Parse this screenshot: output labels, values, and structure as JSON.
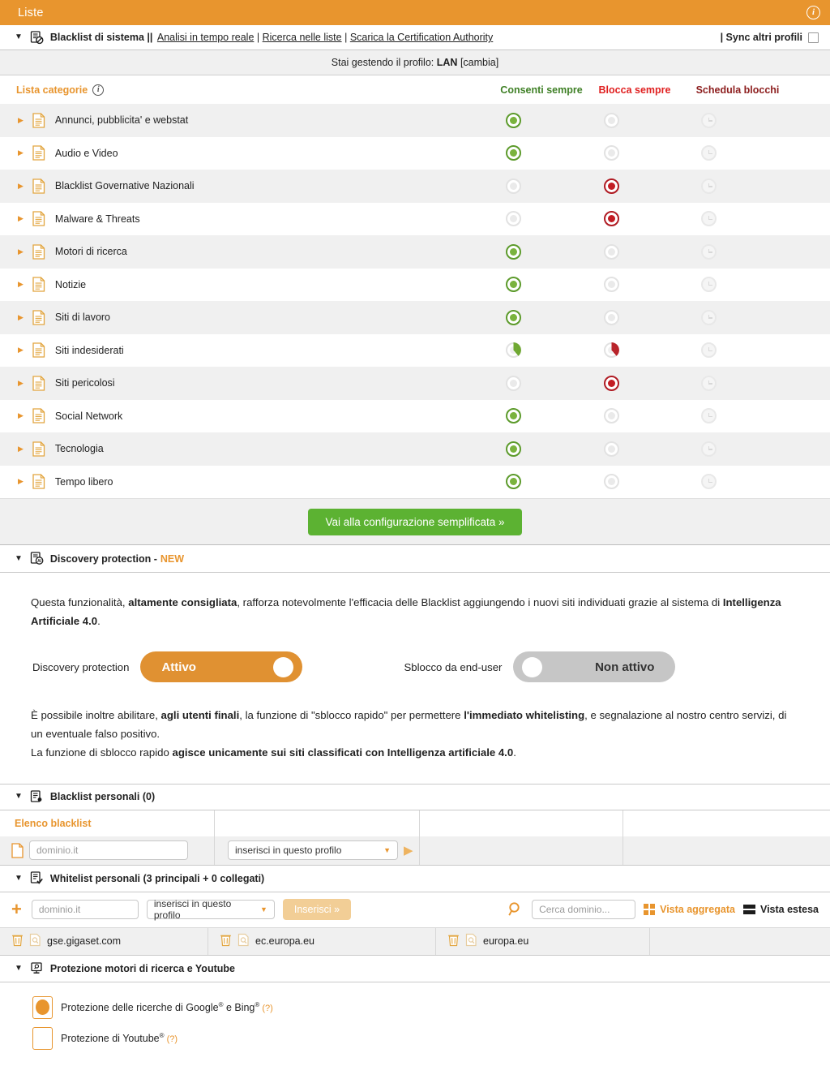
{
  "titlebar": {
    "title": "Liste",
    "info_icon": "info-circle-icon"
  },
  "system_blacklist": {
    "label": "Blacklist di sistema ||",
    "links": [
      {
        "text": "Analisi in tempo reale"
      },
      {
        "text": "Ricerca nelle liste"
      },
      {
        "text": "Scarica la Certification Authority"
      }
    ],
    "sync_label": "| Sync altri profili",
    "sync_checked": false
  },
  "profile_strip": {
    "prefix": "Stai gestendo il profilo:",
    "profile": "LAN",
    "change": "[cambia]"
  },
  "categories_table": {
    "list_label": "Lista categorie",
    "columns": [
      {
        "key": "allow",
        "label": "Consenti sempre",
        "color": "#3f8026"
      },
      {
        "key": "block",
        "label": "Blocca sempre",
        "color": "#e02020"
      },
      {
        "key": "schedule",
        "label": "Schedula blocchi",
        "color": "#8c1d1d"
      }
    ],
    "rows": [
      {
        "name": "Annunci, pubblicita' e webstat",
        "allow": "on",
        "block": "off",
        "schedule": "clock"
      },
      {
        "name": "Audio e Video",
        "allow": "on",
        "block": "off",
        "schedule": "clock"
      },
      {
        "name": "Blacklist Governative Nazionali",
        "allow": "off",
        "block": "on",
        "schedule": "clock"
      },
      {
        "name": "Malware & Threats",
        "allow": "off",
        "block": "on",
        "schedule": "clock"
      },
      {
        "name": "Motori di ricerca",
        "allow": "on",
        "block": "off",
        "schedule": "clock"
      },
      {
        "name": "Notizie",
        "allow": "on",
        "block": "off",
        "schedule": "clock"
      },
      {
        "name": "Siti di lavoro",
        "allow": "on",
        "block": "off",
        "schedule": "clock"
      },
      {
        "name": "Siti indesiderati",
        "allow": "partial",
        "block": "partial",
        "schedule": "clock"
      },
      {
        "name": "Siti pericolosi",
        "allow": "off",
        "block": "on",
        "schedule": "clock"
      },
      {
        "name": "Social Network",
        "allow": "on",
        "block": "off",
        "schedule": "clock"
      },
      {
        "name": "Tecnologia",
        "allow": "on",
        "block": "off",
        "schedule": "clock"
      },
      {
        "name": "Tempo libero",
        "allow": "on",
        "block": "off",
        "schedule": "clock"
      }
    ]
  },
  "simplified_button": {
    "label": "Vai alla configurazione semplificata »",
    "color": "#5cb232"
  },
  "discovery": {
    "header": "Discovery protection -",
    "badge": "NEW",
    "paragraph1_parts": [
      {
        "text": "Questa funzionalità, ",
        "bold": false
      },
      {
        "text": "altamente consigliata",
        "bold": true
      },
      {
        "text": ", rafforza notevolmente l'efficacia delle Blacklist aggiungendo i nuovi siti individuati grazie al sistema di ",
        "bold": false
      },
      {
        "text": "Intelligenza Artificiale 4.0",
        "bold": true
      },
      {
        "text": ".",
        "bold": false
      }
    ],
    "toggle_left": {
      "label": "Discovery protection",
      "state_text": "Attivo",
      "on": true,
      "color": "#e09132"
    },
    "toggle_right": {
      "label": "Sblocco da end-user",
      "state_text": "Non attivo",
      "on": false,
      "color": "#c6c6c6"
    },
    "paragraph2_parts": [
      {
        "text": "È possibile inoltre abilitare, ",
        "bold": false
      },
      {
        "text": "agli utenti finali",
        "bold": true
      },
      {
        "text": ", la funzione di \"sblocco rapido\" per permettere ",
        "bold": false
      },
      {
        "text": "l'immediato whitelisting",
        "bold": true
      },
      {
        "text": ", e segnalazione al nostro centro servizi, di un eventuale falso positivo.",
        "bold": false
      }
    ],
    "paragraph3_parts": [
      {
        "text": "La funzione di sblocco rapido ",
        "bold": false
      },
      {
        "text": "agisce unicamente sui siti classificati con Intelligenza artificiale 4.0",
        "bold": true
      },
      {
        "text": ".",
        "bold": false
      }
    ]
  },
  "personal_blacklist": {
    "header": "Blacklist personali (0)",
    "column_title": "Elenco blacklist",
    "domain_placeholder": "dominio.it",
    "domain_value": "",
    "profile_select_value": "inserisci in questo profilo",
    "go_icon": "play-triangle-icon"
  },
  "personal_whitelist": {
    "header_prefix": "Whitelist personali (",
    "header_main": "3",
    "header_mid": " principali + ",
    "header_linked": "0",
    "header_suffix": " collegati)",
    "header_full": "Whitelist personali (3 principali + 0 collegati)",
    "domain_placeholder": "dominio.it",
    "profile_select_value": "inserisci in questo profilo",
    "insert_button": "Inserisci »",
    "search_placeholder": "Cerca dominio...",
    "view_aggregated": "Vista aggregata",
    "view_extended": "Vista estesa",
    "entries": [
      {
        "domain": "gse.gigaset.com"
      },
      {
        "domain": "ec.europa.eu"
      },
      {
        "domain": "europa.eu"
      }
    ]
  },
  "search_protection": {
    "header": "Protezione motori di ricerca e Youtube",
    "items": [
      {
        "label_pre": "Protezione delle ricerche di Google",
        "label_mid": " e Bing",
        "help": "(?)",
        "checked": true
      },
      {
        "label_pre": "Protezione di Youtube",
        "label_mid": "",
        "help": "(?)",
        "checked": false
      }
    ]
  },
  "colors": {
    "accent_orange": "#e8952e",
    "green": "#5cb232",
    "red": "#c31d24",
    "row_alt": "#f0f0f0"
  }
}
